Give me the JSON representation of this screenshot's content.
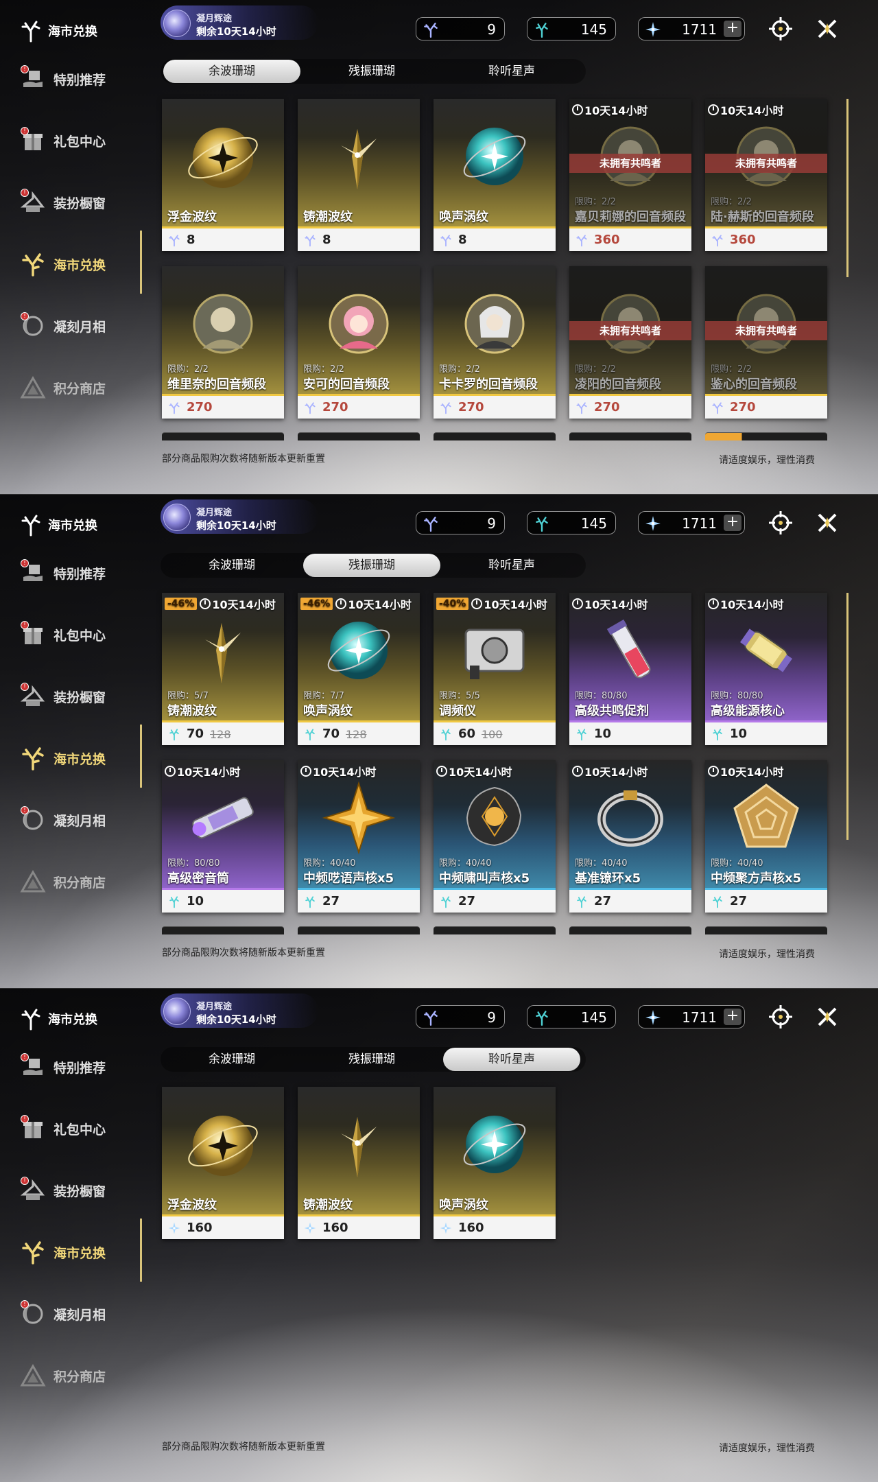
{
  "sidebar": {
    "header": "海市兑换",
    "items": [
      {
        "label": "特别推荐",
        "icon": "gift-hand-icon",
        "badge": true
      },
      {
        "label": "礼包中心",
        "icon": "gift-box-icon",
        "badge": true
      },
      {
        "label": "装扮橱窗",
        "icon": "hanger-icon",
        "badge": true
      },
      {
        "label": "海市兑换",
        "icon": "coral-icon",
        "badge": false,
        "active": true
      },
      {
        "label": "凝刻月相",
        "icon": "moon-icon",
        "badge": true
      },
      {
        "label": "积分商店",
        "icon": "triangle-icon",
        "badge": false,
        "dim": true
      }
    ]
  },
  "event": {
    "title": "凝月辉途",
    "remaining": "剩余10天14小时"
  },
  "currencies": [
    {
      "icon": "coral-purple-icon",
      "value": "9"
    },
    {
      "icon": "coral-teal-icon",
      "value": "145"
    },
    {
      "icon": "star-shard-icon",
      "value": "1711"
    }
  ],
  "plus_label": "+",
  "tabs": [
    "余波珊瑚",
    "残振珊瑚",
    "聆听星声"
  ],
  "footer": {
    "left": "部分商品限购次数将随新版本更新重置",
    "right": "请适度娱乐，理性消费"
  },
  "colors": {
    "accent": "#f1d77a",
    "owned_banner": "#963c37",
    "discount": "#f0a733"
  },
  "panels": [
    {
      "selected_tab": 0,
      "items": [
        {
          "name": "浮金波纹",
          "price": "8",
          "price_icon": "coral-purple-icon",
          "art": "gold-orb",
          "theme": "gold"
        },
        {
          "name": "铸潮波纹",
          "price": "8",
          "price_icon": "coral-purple-icon",
          "art": "gold-blade",
          "theme": "gold"
        },
        {
          "name": "唤声涡纹",
          "price": "8",
          "price_icon": "coral-purple-icon",
          "art": "teal-orb",
          "theme": "gold"
        },
        {
          "name": "嘉贝莉娜的回音频段",
          "price": "360",
          "price_icon": "coral-purple-icon",
          "art": "portrait",
          "theme": "dark",
          "timer": "10天14小时",
          "limit": "限购：2/2",
          "owned": "未拥有共鸣者",
          "red": true
        },
        {
          "name": "陆·赫斯的回音频段",
          "price": "360",
          "price_icon": "coral-purple-icon",
          "art": "portrait",
          "theme": "dark",
          "timer": "10天14小时",
          "limit": "限购：2/2",
          "owned": "未拥有共鸣者",
          "red": true
        },
        {
          "name": "维里奈的回音频段",
          "price": "270",
          "price_icon": "coral-purple-icon",
          "art": "portrait",
          "theme": "gold",
          "limit": "限购：2/2",
          "red": true
        },
        {
          "name": "安可的回音频段",
          "price": "270",
          "price_icon": "coral-purple-icon",
          "art": "portrait-pink",
          "theme": "gold",
          "limit": "限购：2/2",
          "red": true
        },
        {
          "name": "卡卡罗的回音频段",
          "price": "270",
          "price_icon": "coral-purple-icon",
          "art": "portrait-white",
          "theme": "gold",
          "limit": "限购：2/2",
          "red": true
        },
        {
          "name": "凌阳的回音频段",
          "price": "270",
          "price_icon": "coral-purple-icon",
          "art": "portrait",
          "theme": "dark",
          "limit": "限购：2/2",
          "owned": "未拥有共鸣者",
          "red": true
        },
        {
          "name": "鉴心的回音频段",
          "price": "270",
          "price_icon": "coral-purple-icon",
          "art": "portrait",
          "theme": "dark",
          "limit": "限购：2/2",
          "owned": "未拥有共鸣者",
          "red": true
        }
      ]
    },
    {
      "selected_tab": 1,
      "items": [
        {
          "name": "铸潮波纹",
          "price": "70",
          "old_price": "128",
          "discount": "-46%",
          "timer": "10天14小时",
          "limit": "限购：5/7",
          "price_icon": "coral-teal-icon",
          "art": "gold-blade",
          "theme": "gold"
        },
        {
          "name": "唤声涡纹",
          "price": "70",
          "old_price": "128",
          "discount": "-46%",
          "timer": "10天14小时",
          "limit": "限购：7/7",
          "price_icon": "coral-teal-icon",
          "art": "teal-orb",
          "theme": "gold"
        },
        {
          "name": "调频仪",
          "price": "60",
          "old_price": "100",
          "discount": "-40%",
          "timer": "10天14小时",
          "limit": "限购：5/5",
          "price_icon": "coral-teal-icon",
          "art": "device",
          "theme": "gold"
        },
        {
          "name": "高级共鸣促剂",
          "price": "10",
          "timer": "10天14小时",
          "limit": "限购：80/80",
          "price_icon": "coral-teal-icon",
          "art": "vial",
          "theme": "purple"
        },
        {
          "name": "高级能源核心",
          "price": "10",
          "timer": "10天14小时",
          "limit": "限购：80/80",
          "price_icon": "coral-teal-icon",
          "art": "capsule",
          "theme": "purple"
        },
        {
          "name": "高级密音筒",
          "price": "10",
          "timer": "10天14小时",
          "limit": "限购：80/80",
          "price_icon": "coral-teal-icon",
          "art": "cylinder",
          "theme": "purple"
        },
        {
          "name": "中频呓语声核x5",
          "price": "27",
          "timer": "10天14小时",
          "limit": "限购：40/40",
          "price_icon": "coral-teal-icon",
          "art": "star-core",
          "theme": "blue"
        },
        {
          "name": "中频啸叫声核x5",
          "price": "27",
          "timer": "10天14小时",
          "limit": "限购：40/40",
          "price_icon": "coral-teal-icon",
          "art": "dark-core",
          "theme": "blue"
        },
        {
          "name": "基准镣环x5",
          "price": "27",
          "timer": "10天14小时",
          "limit": "限购：40/40",
          "price_icon": "coral-teal-icon",
          "art": "ring",
          "theme": "blue"
        },
        {
          "name": "中频聚方声核x5",
          "price": "27",
          "timer": "10天14小时",
          "limit": "限购：40/40",
          "price_icon": "coral-teal-icon",
          "art": "pentagon",
          "theme": "blue"
        }
      ]
    },
    {
      "selected_tab": 2,
      "items": [
        {
          "name": "浮金波纹",
          "price": "160",
          "price_icon": "star-shard-icon",
          "art": "gold-orb",
          "theme": "gold"
        },
        {
          "name": "铸潮波纹",
          "price": "160",
          "price_icon": "star-shard-icon",
          "art": "gold-blade",
          "theme": "gold"
        },
        {
          "name": "唤声涡纹",
          "price": "160",
          "price_icon": "star-shard-icon",
          "art": "teal-orb",
          "theme": "gold"
        }
      ]
    }
  ]
}
